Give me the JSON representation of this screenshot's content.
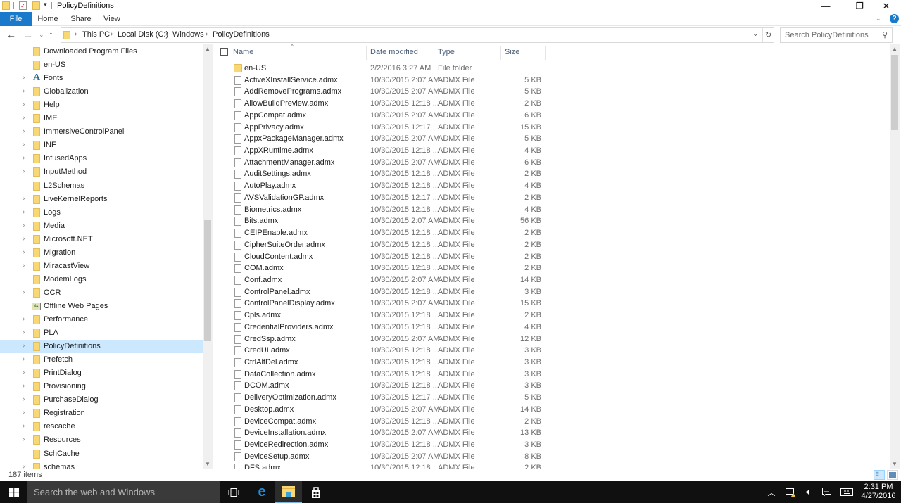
{
  "window": {
    "title": "PolicyDefinitions",
    "controls": {
      "minimize": "—",
      "restore": "❐",
      "close": "✕"
    }
  },
  "ribbon": {
    "tabs": [
      {
        "label": "File",
        "active": true
      },
      {
        "label": "Home"
      },
      {
        "label": "Share"
      },
      {
        "label": "View"
      }
    ],
    "help_label": "?"
  },
  "address": {
    "breadcrumbs": [
      "This PC",
      "Local Disk (C:)",
      "Windows",
      "PolicyDefinitions"
    ],
    "search_placeholder": "Search PolicyDefinitions"
  },
  "nav_pane": {
    "items": [
      {
        "label": "Downloaded Program Files",
        "expandable": false,
        "icon": "folder"
      },
      {
        "label": "en-US",
        "expandable": false,
        "icon": "folder"
      },
      {
        "label": "Fonts",
        "expandable": true,
        "icon": "fonts"
      },
      {
        "label": "Globalization",
        "expandable": true,
        "icon": "folder"
      },
      {
        "label": "Help",
        "expandable": true,
        "icon": "folder"
      },
      {
        "label": "IME",
        "expandable": true,
        "icon": "folder"
      },
      {
        "label": "ImmersiveControlPanel",
        "expandable": true,
        "icon": "folder"
      },
      {
        "label": "INF",
        "expandable": true,
        "icon": "folder"
      },
      {
        "label": "InfusedApps",
        "expandable": true,
        "icon": "folder"
      },
      {
        "label": "InputMethod",
        "expandable": true,
        "icon": "folder"
      },
      {
        "label": "L2Schemas",
        "expandable": false,
        "icon": "folder"
      },
      {
        "label": "LiveKernelReports",
        "expandable": true,
        "icon": "folder"
      },
      {
        "label": "Logs",
        "expandable": true,
        "icon": "folder"
      },
      {
        "label": "Media",
        "expandable": true,
        "icon": "folder"
      },
      {
        "label": "Microsoft.NET",
        "expandable": true,
        "icon": "folder"
      },
      {
        "label": "Migration",
        "expandable": true,
        "icon": "folder"
      },
      {
        "label": "MiracastView",
        "expandable": true,
        "icon": "folder"
      },
      {
        "label": "ModemLogs",
        "expandable": false,
        "icon": "folder"
      },
      {
        "label": "OCR",
        "expandable": true,
        "icon": "folder"
      },
      {
        "label": "Offline Web Pages",
        "expandable": false,
        "icon": "offline"
      },
      {
        "label": "Performance",
        "expandable": true,
        "icon": "folder"
      },
      {
        "label": "PLA",
        "expandable": true,
        "icon": "folder"
      },
      {
        "label": "PolicyDefinitions",
        "expandable": true,
        "icon": "folder",
        "selected": true
      },
      {
        "label": "Prefetch",
        "expandable": true,
        "icon": "folder"
      },
      {
        "label": "PrintDialog",
        "expandable": true,
        "icon": "folder"
      },
      {
        "label": "Provisioning",
        "expandable": true,
        "icon": "folder"
      },
      {
        "label": "PurchaseDialog",
        "expandable": true,
        "icon": "folder"
      },
      {
        "label": "Registration",
        "expandable": true,
        "icon": "folder"
      },
      {
        "label": "rescache",
        "expandable": true,
        "icon": "folder"
      },
      {
        "label": "Resources",
        "expandable": true,
        "icon": "folder"
      },
      {
        "label": "SchCache",
        "expandable": false,
        "icon": "folder"
      },
      {
        "label": "schemas",
        "expandable": true,
        "icon": "folder"
      }
    ]
  },
  "file_list": {
    "columns": {
      "name": "Name",
      "date": "Date modified",
      "type": "Type",
      "size": "Size"
    },
    "rows": [
      {
        "name": "en-US",
        "date": "2/2/2016 3:27 AM",
        "type": "File folder",
        "size": "",
        "folder": true
      },
      {
        "name": "ActiveXInstallService.admx",
        "date": "10/30/2015 2:07 AM",
        "type": "ADMX File",
        "size": "5 KB"
      },
      {
        "name": "AddRemovePrograms.admx",
        "date": "10/30/2015 2:07 AM",
        "type": "ADMX File",
        "size": "5 KB"
      },
      {
        "name": "AllowBuildPreview.admx",
        "date": "10/30/2015 12:18 ...",
        "type": "ADMX File",
        "size": "2 KB"
      },
      {
        "name": "AppCompat.admx",
        "date": "10/30/2015 2:07 AM",
        "type": "ADMX File",
        "size": "6 KB"
      },
      {
        "name": "AppPrivacy.admx",
        "date": "10/30/2015 12:17 ...",
        "type": "ADMX File",
        "size": "15 KB"
      },
      {
        "name": "AppxPackageManager.admx",
        "date": "10/30/2015 2:07 AM",
        "type": "ADMX File",
        "size": "5 KB"
      },
      {
        "name": "AppXRuntime.admx",
        "date": "10/30/2015 12:18 ...",
        "type": "ADMX File",
        "size": "4 KB"
      },
      {
        "name": "AttachmentManager.admx",
        "date": "10/30/2015 2:07 AM",
        "type": "ADMX File",
        "size": "6 KB"
      },
      {
        "name": "AuditSettings.admx",
        "date": "10/30/2015 12:18 ...",
        "type": "ADMX File",
        "size": "2 KB"
      },
      {
        "name": "AutoPlay.admx",
        "date": "10/30/2015 12:18 ...",
        "type": "ADMX File",
        "size": "4 KB"
      },
      {
        "name": "AVSValidationGP.admx",
        "date": "10/30/2015 12:17 ...",
        "type": "ADMX File",
        "size": "2 KB"
      },
      {
        "name": "Biometrics.admx",
        "date": "10/30/2015 12:18 ...",
        "type": "ADMX File",
        "size": "4 KB"
      },
      {
        "name": "Bits.admx",
        "date": "10/30/2015 2:07 AM",
        "type": "ADMX File",
        "size": "56 KB"
      },
      {
        "name": "CEIPEnable.admx",
        "date": "10/30/2015 12:18 ...",
        "type": "ADMX File",
        "size": "2 KB"
      },
      {
        "name": "CipherSuiteOrder.admx",
        "date": "10/30/2015 12:18 ...",
        "type": "ADMX File",
        "size": "2 KB"
      },
      {
        "name": "CloudContent.admx",
        "date": "10/30/2015 12:18 ...",
        "type": "ADMX File",
        "size": "2 KB"
      },
      {
        "name": "COM.admx",
        "date": "10/30/2015 12:18 ...",
        "type": "ADMX File",
        "size": "2 KB"
      },
      {
        "name": "Conf.admx",
        "date": "10/30/2015 2:07 AM",
        "type": "ADMX File",
        "size": "14 KB"
      },
      {
        "name": "ControlPanel.admx",
        "date": "10/30/2015 12:18 ...",
        "type": "ADMX File",
        "size": "3 KB"
      },
      {
        "name": "ControlPanelDisplay.admx",
        "date": "10/30/2015 2:07 AM",
        "type": "ADMX File",
        "size": "15 KB"
      },
      {
        "name": "Cpls.admx",
        "date": "10/30/2015 12:18 ...",
        "type": "ADMX File",
        "size": "2 KB"
      },
      {
        "name": "CredentialProviders.admx",
        "date": "10/30/2015 12:18 ...",
        "type": "ADMX File",
        "size": "4 KB"
      },
      {
        "name": "CredSsp.admx",
        "date": "10/30/2015 2:07 AM",
        "type": "ADMX File",
        "size": "12 KB"
      },
      {
        "name": "CredUI.admx",
        "date": "10/30/2015 12:18 ...",
        "type": "ADMX File",
        "size": "3 KB"
      },
      {
        "name": "CtrlAltDel.admx",
        "date": "10/30/2015 12:18 ...",
        "type": "ADMX File",
        "size": "3 KB"
      },
      {
        "name": "DataCollection.admx",
        "date": "10/30/2015 12:18 ...",
        "type": "ADMX File",
        "size": "3 KB"
      },
      {
        "name": "DCOM.admx",
        "date": "10/30/2015 12:18 ...",
        "type": "ADMX File",
        "size": "3 KB"
      },
      {
        "name": "DeliveryOptimization.admx",
        "date": "10/30/2015 12:17 ...",
        "type": "ADMX File",
        "size": "5 KB"
      },
      {
        "name": "Desktop.admx",
        "date": "10/30/2015 2:07 AM",
        "type": "ADMX File",
        "size": "14 KB"
      },
      {
        "name": "DeviceCompat.admx",
        "date": "10/30/2015 12:18 ...",
        "type": "ADMX File",
        "size": "2 KB"
      },
      {
        "name": "DeviceInstallation.admx",
        "date": "10/30/2015 2:07 AM",
        "type": "ADMX File",
        "size": "13 KB"
      },
      {
        "name": "DeviceRedirection.admx",
        "date": "10/30/2015 12:18 ...",
        "type": "ADMX File",
        "size": "3 KB"
      },
      {
        "name": "DeviceSetup.admx",
        "date": "10/30/2015 2:07 AM",
        "type": "ADMX File",
        "size": "8 KB"
      },
      {
        "name": "DFS.admx",
        "date": "10/30/2015 12:18 ...",
        "type": "ADMX File",
        "size": "2 KB"
      }
    ]
  },
  "status": {
    "item_count": "187 items"
  },
  "taskbar": {
    "search_placeholder": "Search the web and Windows",
    "time": "2:31 PM",
    "date": "4/27/2016"
  }
}
